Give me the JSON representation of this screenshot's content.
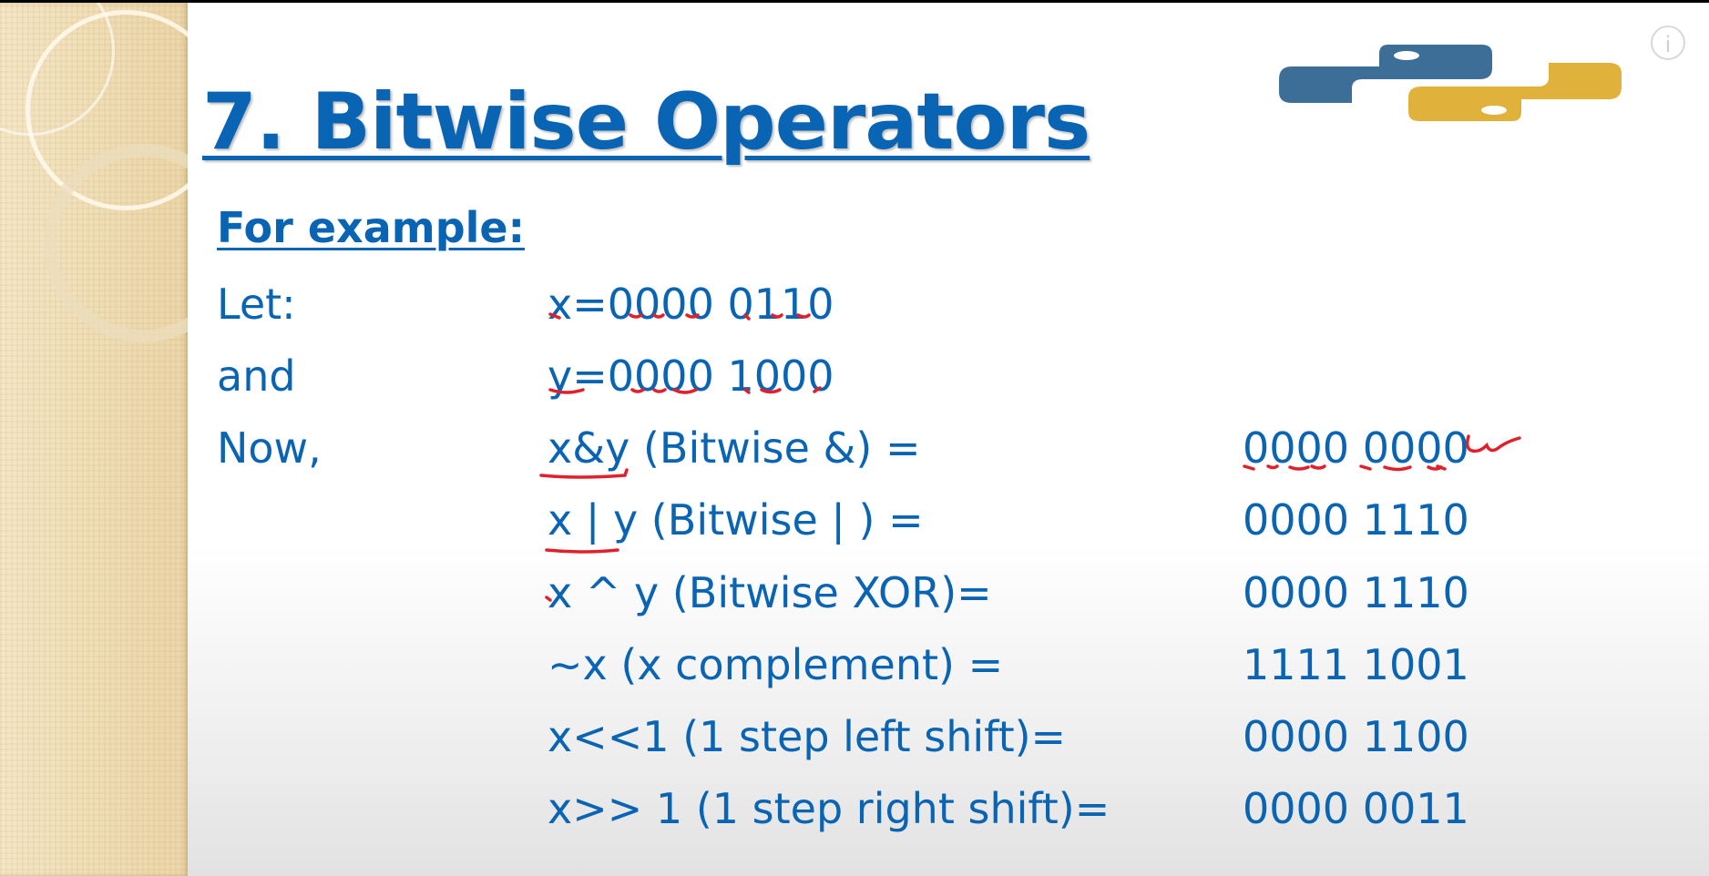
{
  "slide": {
    "title": "7. Bitwise Operators",
    "subheading": "For example:",
    "rows": [
      {
        "label": "Let:",
        "expression": "x=0000 0110",
        "result": ""
      },
      {
        "label": "and",
        "expression": "y=0000 1000",
        "result": ""
      },
      {
        "label": "Now,",
        "expression": "x&y (Bitwise &) =",
        "result": "0000 0000"
      },
      {
        "label": "",
        "expression": "x | y (Bitwise | ) =",
        "result": "0000 1110"
      },
      {
        "label": "",
        "expression": "x ^ y (Bitwise XOR)=",
        "result": "0000 1110"
      },
      {
        "label": "",
        "expression": "~x (x complement) =",
        "result": "1111 1001"
      },
      {
        "label": "",
        "expression": "x<<1 (1 step left shift)=",
        "result": "0000 1100"
      },
      {
        "label": "",
        "expression": "x>> 1 (1 step right shift)=",
        "result": "0000 0011"
      }
    ]
  },
  "logo": {
    "icon": "python-logo-icon",
    "colors": {
      "blue": "#3c6e98",
      "yellow": "#e0b23c"
    }
  },
  "overlay": {
    "info_glyph": "i",
    "icon": "info-icon"
  },
  "colors": {
    "text": "#0a64b4",
    "annotation": "#e0202a",
    "side_panel": "#f1dfb7"
  }
}
